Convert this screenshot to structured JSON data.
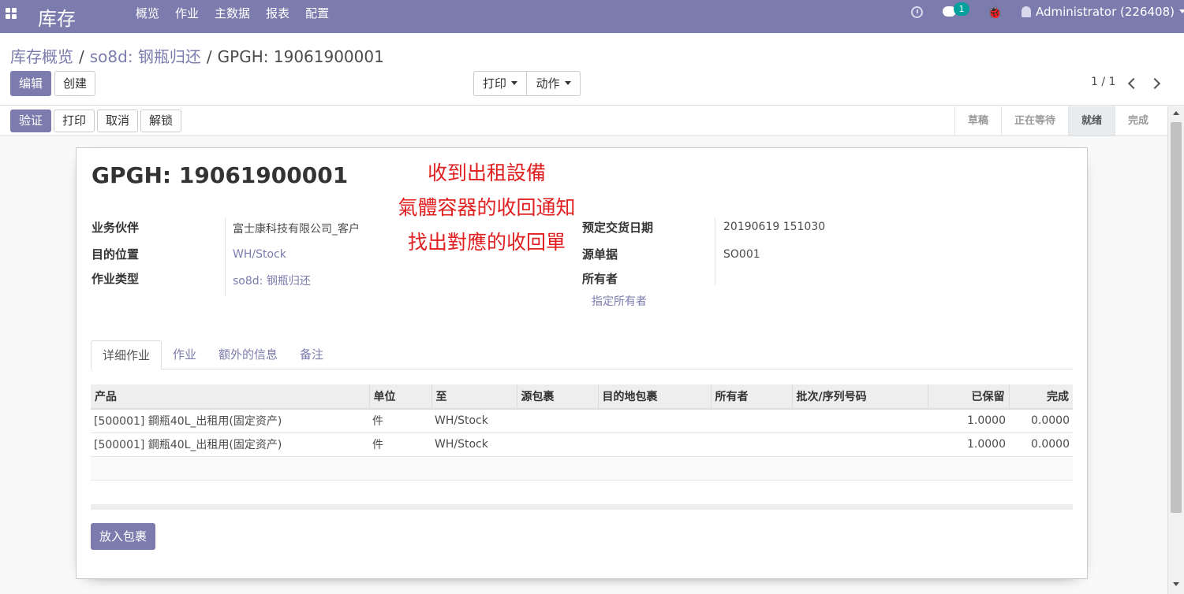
{
  "topbar": {
    "brand": "库存",
    "menu": [
      "概览",
      "作业",
      "主数据",
      "报表",
      "配置"
    ],
    "chat_badge": "1",
    "user": "Administrator (226408)"
  },
  "breadcrumb": {
    "items": [
      "库存概览",
      "so8d: 钢瓶归还"
    ],
    "current": "GPGH: 19061900001",
    "sep": "/"
  },
  "buttons": {
    "edit": "编辑",
    "create": "创建",
    "print": "打印",
    "action": "动作",
    "validate": "验证",
    "print2": "打印",
    "cancel": "取消",
    "unlock": "解锁",
    "put_in_pack": "放入包裹"
  },
  "pager": {
    "value": "1 / 1"
  },
  "status": {
    "steps": [
      "草稿",
      "正在等待",
      "就绪",
      "完成"
    ],
    "active": "就绪"
  },
  "record": {
    "title": "GPGH: 19061900001",
    "overlay": [
      "收到出租設備",
      "氣體容器的收回通知",
      "找出對應的收回單"
    ],
    "fields": {
      "partner_label": "业务伙伴",
      "partner_value": "富士康科技有限公司_客户",
      "dest_label": "目的位置",
      "dest_value": "WH/Stock",
      "optype_label": "作业类型",
      "optype_value": "so8d: 钢瓶归还",
      "date_label": "预定交货日期",
      "date_value": "20190619 151030",
      "origin_label": "源单据",
      "origin_value": "SO001",
      "owner_label": "所有者",
      "owner_placeholder": "指定所有者"
    }
  },
  "tabs": [
    "详细作业",
    "作业",
    "额外的信息",
    "备注"
  ],
  "table": {
    "headers": [
      "产品",
      "单位",
      "至",
      "源包裹",
      "目的地包裹",
      "所有者",
      "批次/序列号码",
      "已保留",
      "完成"
    ],
    "rows": [
      [
        "[500001] 鋼瓶40L_出租用(固定资产)",
        "件",
        "WH/Stock",
        "",
        "",
        "",
        "",
        "1.0000",
        "0.0000"
      ],
      [
        "[500001] 鋼瓶40L_出租用(固定资产)",
        "件",
        "WH/Stock",
        "",
        "",
        "",
        "",
        "1.0000",
        "0.0000"
      ]
    ]
  },
  "colors": {
    "brand": "#7c7bad",
    "overlay_text": "#e02020",
    "badge": "#00a09d"
  }
}
